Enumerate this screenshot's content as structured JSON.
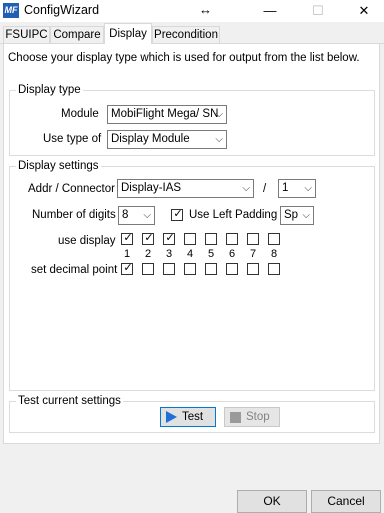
{
  "window": {
    "title": "ConfigWizard",
    "app_icon": "MF",
    "resize_icon": "↔",
    "minimize": "—",
    "maximize": "☐",
    "close": "✕"
  },
  "tabs": [
    {
      "label": "FSUIPC",
      "active": false
    },
    {
      "label": "Compare",
      "active": false
    },
    {
      "label": "Display",
      "active": true
    },
    {
      "label": "Precondition",
      "active": false
    }
  ],
  "instruction": "Choose your display type which is used for output from the list below.",
  "display_type": {
    "title": "Display type",
    "module_label": "Module",
    "module_value": "MobiFlight Mega/ SN",
    "use_type_label": "Use type of",
    "use_type_value": "Display Module"
  },
  "display_settings": {
    "title": "Display settings",
    "addr_label": "Addr / Connector",
    "addr_value": "Display-IAS",
    "slash": "/",
    "connector_value": "1",
    "digits_label": "Number of digits",
    "digits_value": "8",
    "left_padding_label": "Use Left Padding",
    "left_padding_checked": true,
    "padding_char_value": "Sp",
    "use_display_label": "use display",
    "digit_numbers": [
      "1",
      "2",
      "3",
      "4",
      "5",
      "6",
      "7",
      "8"
    ],
    "use_display_checked": [
      true,
      true,
      true,
      false,
      false,
      false,
      false,
      false
    ],
    "decimal_label": "set decimal point",
    "decimal_checked": [
      true,
      false,
      false,
      false,
      false,
      false,
      false,
      false
    ]
  },
  "test": {
    "title": "Test current settings",
    "test_label": "Test",
    "stop_label": "Stop",
    "play_icon_color": "#1e6fd9"
  },
  "footer": {
    "ok_label": "OK",
    "cancel_label": "Cancel"
  },
  "glyphs": {
    "dropdown": "⌵",
    "check": "✓"
  }
}
